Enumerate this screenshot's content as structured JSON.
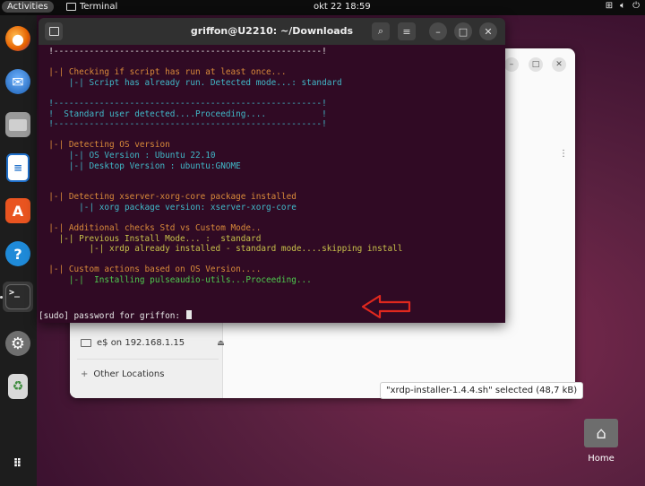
{
  "topbar": {
    "activities": "Activities",
    "app_name": "Terminal",
    "clock": "okt 22  18:59",
    "tray_icons": [
      "network-icon",
      "volume-icon",
      "power-icon"
    ]
  },
  "dock": {
    "items": [
      {
        "name": "firefox",
        "icon": "firefox-icon",
        "color": "#e66000"
      },
      {
        "name": "thunderbird",
        "icon": "mail-icon",
        "color": "#2a7ad1"
      },
      {
        "name": "files",
        "icon": "folder-icon",
        "color": "#8a8a8a"
      },
      {
        "name": "writer",
        "icon": "document-icon",
        "color": "#1e6fc9"
      },
      {
        "name": "software",
        "icon": "store-icon",
        "color": "#e95420"
      },
      {
        "name": "help",
        "icon": "help-icon",
        "color": "#1f8ad8"
      },
      {
        "name": "terminal",
        "icon": "terminal-icon",
        "color": "#333333"
      },
      {
        "name": "settings",
        "icon": "gear-icon",
        "color": "#777777"
      },
      {
        "name": "trash",
        "icon": "trash-icon",
        "color": "#6aa06a"
      }
    ],
    "apps_grid": "apps-grid-icon"
  },
  "files": {
    "sidebar": {
      "network_item": "e$ on 192.168.1.15",
      "other_locations": "Other Locations"
    },
    "status": "\"xrdp-installer-1.4.4.sh\" selected (48,7 kB)"
  },
  "terminal": {
    "title": "griffon@U2210: ~/Downloads",
    "lines": [
      {
        "text": "  !-----------------------------------------------------!",
        "color": "white"
      },
      {
        "text": "",
        "color": "white"
      },
      {
        "text": "  |-| Checking if script has run at least once...",
        "color": "orange"
      },
      {
        "text": "      |-| Script has already run. Detected mode...: standard",
        "color": "cyan"
      },
      {
        "text": "",
        "color": "white"
      },
      {
        "text": "  !-----------------------------------------------------!",
        "color": "cyan"
      },
      {
        "text": "  !  Standard user detected....Proceeding....           !",
        "color": "cyan"
      },
      {
        "text": "  !-----------------------------------------------------!",
        "color": "cyan"
      },
      {
        "text": "",
        "color": "white"
      },
      {
        "text": "  |-| Detecting OS version",
        "color": "orange"
      },
      {
        "text": "      |-| OS Version : Ubuntu 22.10",
        "color": "cyan"
      },
      {
        "text": "      |-| Desktop Version : ubuntu:GNOME",
        "color": "cyan"
      },
      {
        "text": "",
        "color": "white"
      },
      {
        "text": "",
        "color": "white"
      },
      {
        "text": "  |-| Detecting xserver-xorg-core package installed",
        "color": "orange"
      },
      {
        "text": "        |-| xorg package version: xserver-xorg-core",
        "color": "cyan"
      },
      {
        "text": "",
        "color": "white"
      },
      {
        "text": "  |-| Additional checks Std vs Custom Mode..",
        "color": "orange"
      },
      {
        "text": "    |-| Previous Install Mode... :  standard",
        "color": "yellow"
      },
      {
        "text": "          |-| xrdp already installed - standard mode....skipping install",
        "color": "yellow"
      },
      {
        "text": "",
        "color": "white"
      },
      {
        "text": "  |-| Custom actions based on OS Version....",
        "color": "orange"
      },
      {
        "text": "      |-|  Installing pulseaudio-utils...Proceeding...",
        "color": "green"
      }
    ],
    "prompt": "[sudo] password for griffon: "
  },
  "desktop": {
    "home_label": "Home"
  },
  "colors": {
    "terminal_bg": "#300a24",
    "arrow": "#e0281e",
    "accent": "#e95420"
  }
}
